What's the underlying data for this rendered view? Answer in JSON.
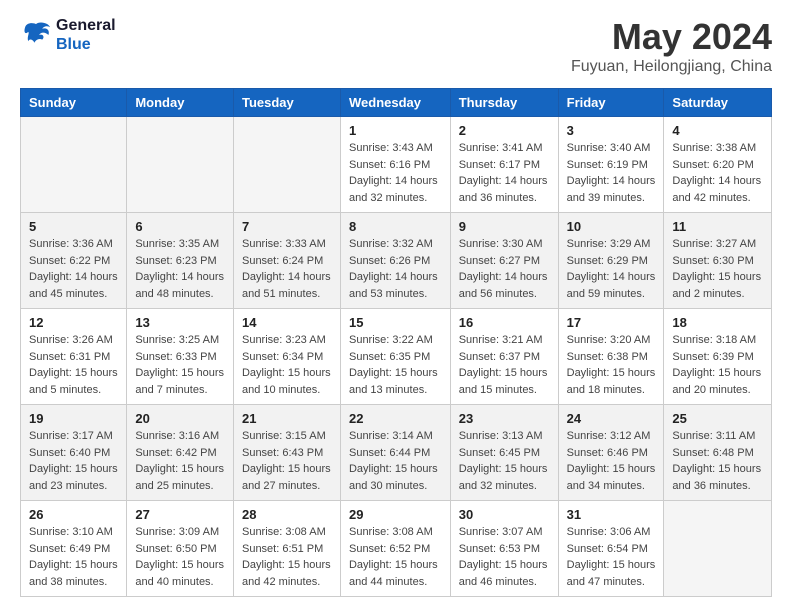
{
  "app": {
    "logo_line1": "General",
    "logo_line2": "Blue"
  },
  "header": {
    "title": "May 2024",
    "subtitle": "Fuyuan, Heilongjiang, China"
  },
  "days_of_week": [
    "Sunday",
    "Monday",
    "Tuesday",
    "Wednesday",
    "Thursday",
    "Friday",
    "Saturday"
  ],
  "weeks": [
    [
      {
        "day": "",
        "info": ""
      },
      {
        "day": "",
        "info": ""
      },
      {
        "day": "",
        "info": ""
      },
      {
        "day": "1",
        "info": "Sunrise: 3:43 AM\nSunset: 6:16 PM\nDaylight: 14 hours\nand 32 minutes."
      },
      {
        "day": "2",
        "info": "Sunrise: 3:41 AM\nSunset: 6:17 PM\nDaylight: 14 hours\nand 36 minutes."
      },
      {
        "day": "3",
        "info": "Sunrise: 3:40 AM\nSunset: 6:19 PM\nDaylight: 14 hours\nand 39 minutes."
      },
      {
        "day": "4",
        "info": "Sunrise: 3:38 AM\nSunset: 6:20 PM\nDaylight: 14 hours\nand 42 minutes."
      }
    ],
    [
      {
        "day": "5",
        "info": "Sunrise: 3:36 AM\nSunset: 6:22 PM\nDaylight: 14 hours\nand 45 minutes."
      },
      {
        "day": "6",
        "info": "Sunrise: 3:35 AM\nSunset: 6:23 PM\nDaylight: 14 hours\nand 48 minutes."
      },
      {
        "day": "7",
        "info": "Sunrise: 3:33 AM\nSunset: 6:24 PM\nDaylight: 14 hours\nand 51 minutes."
      },
      {
        "day": "8",
        "info": "Sunrise: 3:32 AM\nSunset: 6:26 PM\nDaylight: 14 hours\nand 53 minutes."
      },
      {
        "day": "9",
        "info": "Sunrise: 3:30 AM\nSunset: 6:27 PM\nDaylight: 14 hours\nand 56 minutes."
      },
      {
        "day": "10",
        "info": "Sunrise: 3:29 AM\nSunset: 6:29 PM\nDaylight: 14 hours\nand 59 minutes."
      },
      {
        "day": "11",
        "info": "Sunrise: 3:27 AM\nSunset: 6:30 PM\nDaylight: 15 hours\nand 2 minutes."
      }
    ],
    [
      {
        "day": "12",
        "info": "Sunrise: 3:26 AM\nSunset: 6:31 PM\nDaylight: 15 hours\nand 5 minutes."
      },
      {
        "day": "13",
        "info": "Sunrise: 3:25 AM\nSunset: 6:33 PM\nDaylight: 15 hours\nand 7 minutes."
      },
      {
        "day": "14",
        "info": "Sunrise: 3:23 AM\nSunset: 6:34 PM\nDaylight: 15 hours\nand 10 minutes."
      },
      {
        "day": "15",
        "info": "Sunrise: 3:22 AM\nSunset: 6:35 PM\nDaylight: 15 hours\nand 13 minutes."
      },
      {
        "day": "16",
        "info": "Sunrise: 3:21 AM\nSunset: 6:37 PM\nDaylight: 15 hours\nand 15 minutes."
      },
      {
        "day": "17",
        "info": "Sunrise: 3:20 AM\nSunset: 6:38 PM\nDaylight: 15 hours\nand 18 minutes."
      },
      {
        "day": "18",
        "info": "Sunrise: 3:18 AM\nSunset: 6:39 PM\nDaylight: 15 hours\nand 20 minutes."
      }
    ],
    [
      {
        "day": "19",
        "info": "Sunrise: 3:17 AM\nSunset: 6:40 PM\nDaylight: 15 hours\nand 23 minutes."
      },
      {
        "day": "20",
        "info": "Sunrise: 3:16 AM\nSunset: 6:42 PM\nDaylight: 15 hours\nand 25 minutes."
      },
      {
        "day": "21",
        "info": "Sunrise: 3:15 AM\nSunset: 6:43 PM\nDaylight: 15 hours\nand 27 minutes."
      },
      {
        "day": "22",
        "info": "Sunrise: 3:14 AM\nSunset: 6:44 PM\nDaylight: 15 hours\nand 30 minutes."
      },
      {
        "day": "23",
        "info": "Sunrise: 3:13 AM\nSunset: 6:45 PM\nDaylight: 15 hours\nand 32 minutes."
      },
      {
        "day": "24",
        "info": "Sunrise: 3:12 AM\nSunset: 6:46 PM\nDaylight: 15 hours\nand 34 minutes."
      },
      {
        "day": "25",
        "info": "Sunrise: 3:11 AM\nSunset: 6:48 PM\nDaylight: 15 hours\nand 36 minutes."
      }
    ],
    [
      {
        "day": "26",
        "info": "Sunrise: 3:10 AM\nSunset: 6:49 PM\nDaylight: 15 hours\nand 38 minutes."
      },
      {
        "day": "27",
        "info": "Sunrise: 3:09 AM\nSunset: 6:50 PM\nDaylight: 15 hours\nand 40 minutes."
      },
      {
        "day": "28",
        "info": "Sunrise: 3:08 AM\nSunset: 6:51 PM\nDaylight: 15 hours\nand 42 minutes."
      },
      {
        "day": "29",
        "info": "Sunrise: 3:08 AM\nSunset: 6:52 PM\nDaylight: 15 hours\nand 44 minutes."
      },
      {
        "day": "30",
        "info": "Sunrise: 3:07 AM\nSunset: 6:53 PM\nDaylight: 15 hours\nand 46 minutes."
      },
      {
        "day": "31",
        "info": "Sunrise: 3:06 AM\nSunset: 6:54 PM\nDaylight: 15 hours\nand 47 minutes."
      },
      {
        "day": "",
        "info": ""
      }
    ]
  ]
}
